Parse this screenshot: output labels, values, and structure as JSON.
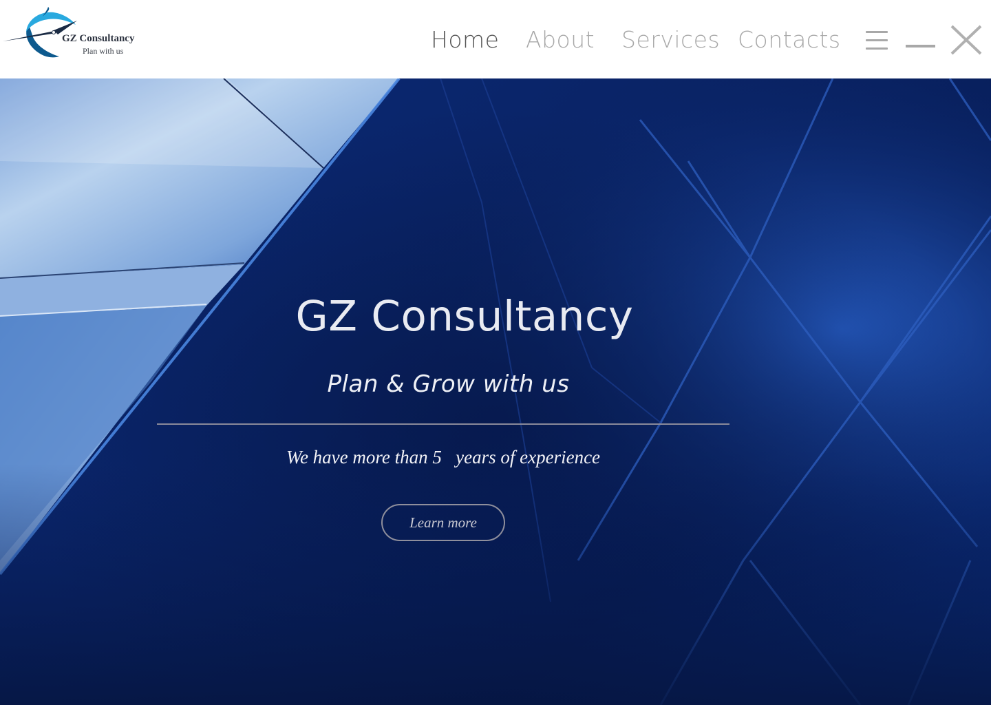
{
  "logo": {
    "title": "GZ Consultancy",
    "tagline": "Plan with us",
    "icon": "compass-swoosh-logo",
    "colors": {
      "dark": "#0d5a8e",
      "light": "#29a9df"
    }
  },
  "nav": {
    "items": [
      {
        "label": "Home",
        "active": true
      },
      {
        "label": "About",
        "active": false
      },
      {
        "label": "Services",
        "active": false
      },
      {
        "label": "Contacts",
        "active": false
      }
    ],
    "menu_icon": "hamburger-icon",
    "minimize_icon": "minimize-icon",
    "close_icon": "close-icon"
  },
  "hero": {
    "title": "GZ Consultancy",
    "subtitle": "Plan & Grow with us",
    "experience": "We have more than 5   years of experience",
    "button_label": "Learn more",
    "background": "blue-geometric-architecture-image",
    "colors": {
      "primary": "#0a2467",
      "accent": "#1e4fb8"
    }
  }
}
